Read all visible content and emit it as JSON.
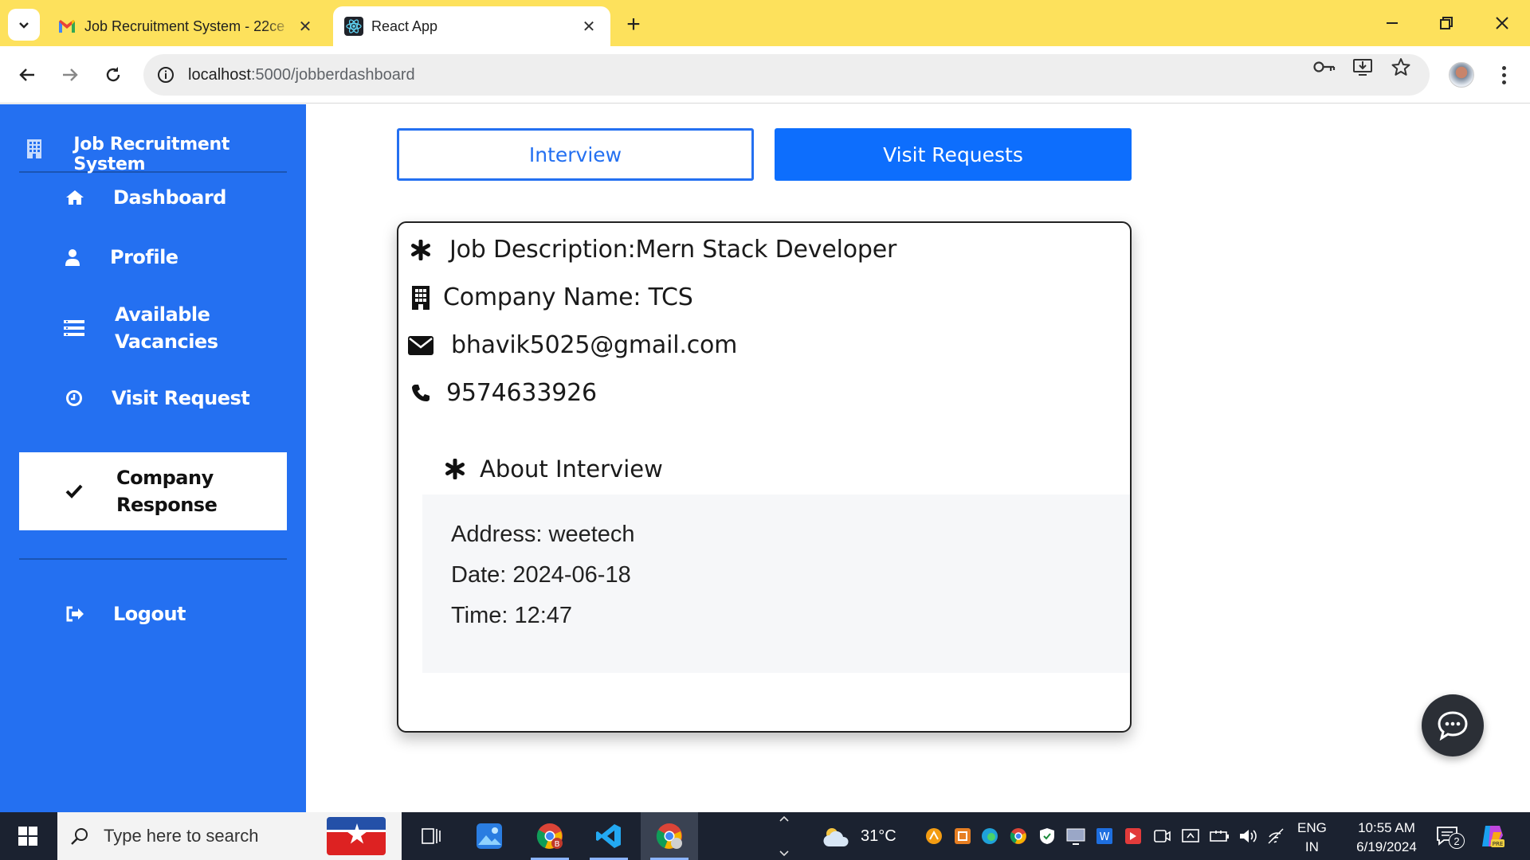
{
  "browser": {
    "tabs": [
      {
        "title": "Job Recruitment System - 22ce",
        "favicon": "gmail-icon",
        "active": false
      },
      {
        "title": "React App",
        "favicon": "react-icon",
        "active": true
      }
    ],
    "url_host": "localhost",
    "url_path": ":5000/jobberdashboard",
    "accent": "#fde15c"
  },
  "sidebar": {
    "brand": "Job Recruitment System",
    "items": [
      {
        "label": "Dashboard",
        "icon": "home-icon"
      },
      {
        "label": "Profile",
        "icon": "user-icon"
      },
      {
        "label": "Available Vacancies",
        "icon": "list-icon"
      },
      {
        "label": "Visit Request",
        "icon": "clock-icon"
      },
      {
        "label": "Company Response",
        "icon": "check-icon",
        "active": true
      }
    ],
    "logout": {
      "label": "Logout",
      "icon": "sign-out-icon"
    },
    "color": "#2470f1"
  },
  "main": {
    "buttons": {
      "interview": "Interview",
      "visit_requests": "Visit Requests"
    },
    "card": {
      "job_description": "Job Description:Mern Stack Developer",
      "company_name": "Company Name: TCS",
      "email": "bhavik5025@gmail.com",
      "phone": "9574633926",
      "about_title": "About Interview",
      "address": "Address: weetech",
      "date": "Date: 2024-06-18",
      "time": "Time: 12:47"
    }
  },
  "taskbar": {
    "search_placeholder": "Type here to search",
    "weather": "31°C",
    "lang_line1": "ENG",
    "lang_line2": "IN",
    "time": "10:55 AM",
    "date": "6/19/2024",
    "notifications": "2"
  }
}
